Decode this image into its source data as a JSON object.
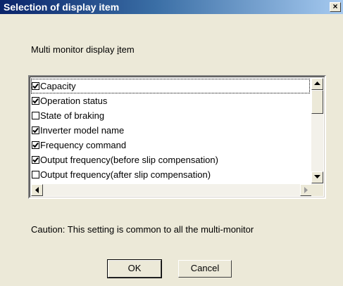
{
  "window": {
    "title": "Selection of display item",
    "close_glyph": "×"
  },
  "group": {
    "label_pre": "Multi monitor display ",
    "label_access": "i",
    "label_post": "tem"
  },
  "list": {
    "items": [
      {
        "label": "Capacity",
        "checked": true,
        "focused": true
      },
      {
        "label": "Operation status",
        "checked": true
      },
      {
        "label": "State of braking",
        "checked": false
      },
      {
        "label": "Inverter model name",
        "checked": true
      },
      {
        "label": "Frequency command",
        "checked": true
      },
      {
        "label": "Output frequency(before slip compensation)",
        "checked": true
      },
      {
        "label": "Output frequency(after slip compensation)",
        "checked": false
      }
    ]
  },
  "caution_text": "Caution: This setting is common to all the multi-monitor",
  "buttons": {
    "ok": "OK",
    "cancel": "Cancel"
  }
}
